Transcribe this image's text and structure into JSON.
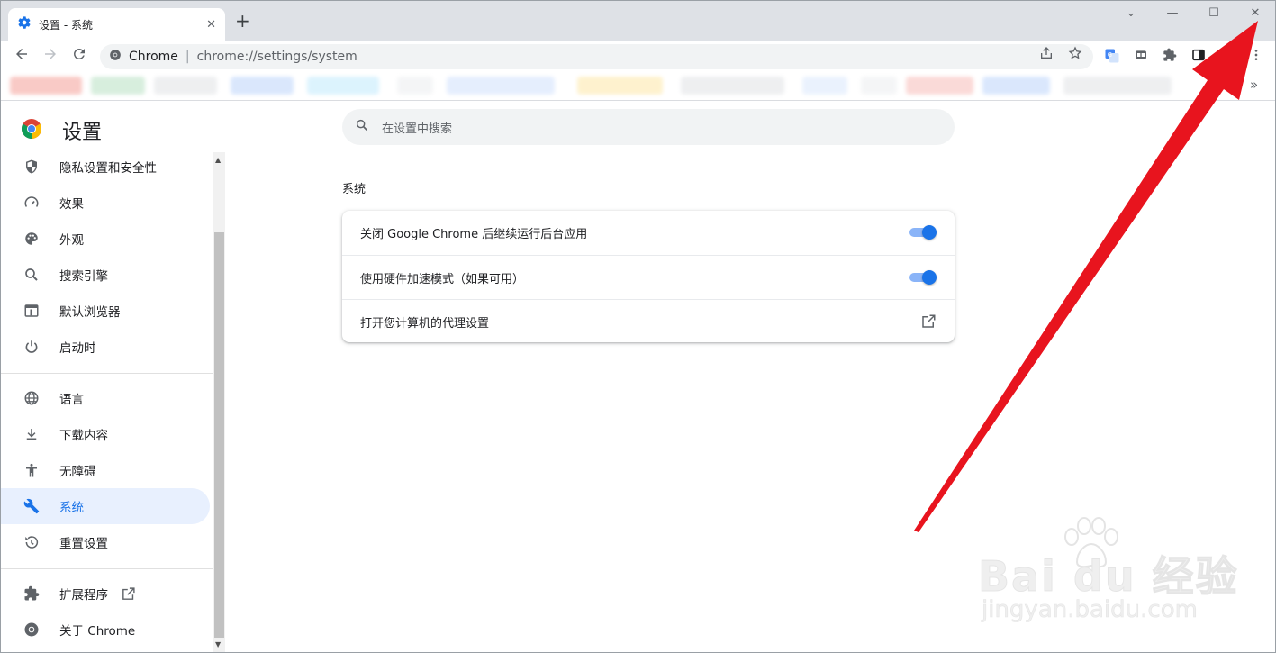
{
  "tab": {
    "title": "设置 - 系统",
    "close": "✕",
    "new_tab": "+"
  },
  "window_controls": {
    "dropdown": "⌄",
    "minimize": "—",
    "maximize": "☐",
    "close": "✕"
  },
  "omnibox": {
    "site": "Chrome",
    "url": "chrome://settings/system"
  },
  "bookmarks": {
    "overflow": "»"
  },
  "settings": {
    "title": "设置"
  },
  "search": {
    "placeholder": "在设置中搜索"
  },
  "sidebar": {
    "items": [
      {
        "label": "隐私设置和安全性",
        "icon": "shield-icon"
      },
      {
        "label": "效果",
        "icon": "gauge-icon"
      },
      {
        "label": "外观",
        "icon": "palette-icon"
      },
      {
        "label": "搜索引擎",
        "icon": "search-icon"
      },
      {
        "label": "默认浏览器",
        "icon": "browser-icon"
      },
      {
        "label": "启动时",
        "icon": "power-icon"
      },
      {
        "label": "语言",
        "icon": "globe-icon"
      },
      {
        "label": "下载内容",
        "icon": "download-icon"
      },
      {
        "label": "无障碍",
        "icon": "accessibility-icon"
      },
      {
        "label": "系统",
        "icon": "wrench-icon",
        "active": true
      },
      {
        "label": "重置设置",
        "icon": "history-icon"
      },
      {
        "label": "扩展程序",
        "icon": "puzzle-icon"
      },
      {
        "label": "关于 Chrome",
        "icon": "chrome-icon"
      }
    ]
  },
  "system": {
    "section_title": "系统",
    "rows": [
      {
        "label": "关闭 Google Chrome 后继续运行后台应用",
        "toggle": true
      },
      {
        "label": "使用硬件加速模式（如果可用）",
        "toggle": true
      },
      {
        "label": "打开您计算机的代理设置",
        "external": true
      }
    ]
  },
  "watermark": {
    "brand": "Bai du 经验",
    "sub": "jingyan.baidu.com"
  },
  "colors": {
    "accent": "#1a73e8",
    "accent_light": "#8ab4f8",
    "active_bg": "#e8f0fe",
    "arrow": "#e8141e"
  }
}
